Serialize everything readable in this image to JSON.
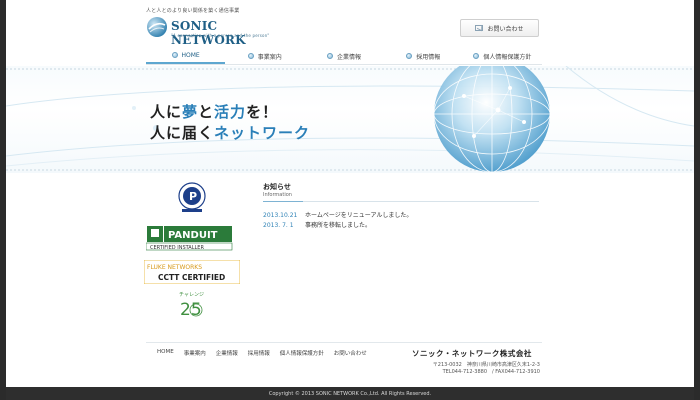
{
  "header": {
    "tagline": "人と人とのより良い関係を築く通信事業",
    "logo_name": "SONIC NETWORK",
    "logo_sub": "\"A connection with a person and the person\"",
    "contact_label": "お問い合わせ"
  },
  "nav": {
    "items": [
      {
        "label": "HOME"
      },
      {
        "label": "事業案内"
      },
      {
        "label": "企業情報"
      },
      {
        "label": "採用情報"
      },
      {
        "label": "個人情報保護方針"
      }
    ]
  },
  "hero": {
    "line1_a": "人に",
    "line1_b": "夢",
    "line1_c": "と",
    "line1_d": "活力",
    "line1_e": "を！",
    "line2_a": "人に届く",
    "line2_b": "ネットワーク"
  },
  "badges": {
    "panduit_name": "PANDUIT",
    "panduit_sub": "CERTIFIED INSTALLER",
    "fluke_top": "FLUKE NETWORKS",
    "fluke_bottom": "CCTT CERTIFIED",
    "challenge_label": "チャレンジ",
    "challenge_num": "25"
  },
  "news": {
    "title": "お知らせ",
    "subtitle": "Information",
    "items": [
      {
        "date": "2013.10.21",
        "text": "ホームページをリニューアルしました。"
      },
      {
        "date": "2013. 7. 1",
        "text": "事務所を移転しました。"
      }
    ]
  },
  "footer": {
    "nav": [
      "HOME",
      "事業案内",
      "企業情報",
      "採用情報",
      "個人情報保護方針",
      "お問い合わせ"
    ],
    "company": "ソニック・ネットワーク株式会社",
    "addr1": "〒213-0032　神奈川県川崎市高津区久末1-2-3",
    "addr2": "TEL044-712-3880　/ FAX044-712-3910",
    "copyright": "Copyright © 2013 SONIC NETWORK Co.,Ltd. All Rights Reserved."
  },
  "colors": {
    "accent": "#2a7fb8",
    "logo": "#1f5f86",
    "footer_bar": "#2e2e2e"
  }
}
